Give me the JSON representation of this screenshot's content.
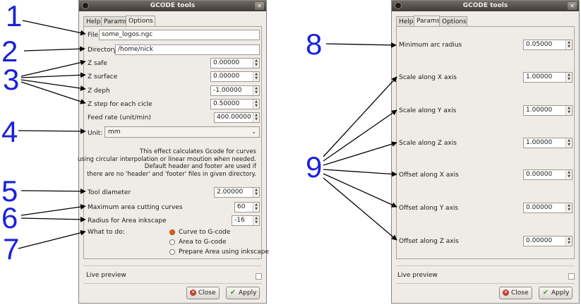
{
  "left": {
    "title": "GCODE tools",
    "tabs": [
      "Help",
      "Params",
      "Options"
    ],
    "active_tab": "Options",
    "file": {
      "label": "File",
      "value": "some_logos.ngc"
    },
    "directory": {
      "label": "Directory",
      "value": "/home/nick"
    },
    "z_safe": {
      "label": "Z safe",
      "value": "0.00000"
    },
    "z_surface": {
      "label": "Z surface",
      "value": "0.00000"
    },
    "z_deph": {
      "label": "Z deph",
      "value": "-1.00000"
    },
    "z_step": {
      "label": "Z step for each cicle",
      "value": "0.50000"
    },
    "feed_rate": {
      "label": "Feed rate (unit/min)",
      "value": "400.00000"
    },
    "unit": {
      "label": "Unit:",
      "value": "mm"
    },
    "description": [
      "This effect calculates Gcode for curves",
      "using circular interpolation or linear moution when needed.",
      "Default header and footer are used if",
      "there are no 'header' and 'footer' files in given directory."
    ],
    "tool_diameter": {
      "label": "Tool diameter",
      "value": "2.00000"
    },
    "max_area_curves": {
      "label": "Maximum area cutting curves",
      "value": "60"
    },
    "radius_area": {
      "label": "Radius for Area inkscape",
      "value": "-16"
    },
    "what_to_do": {
      "label": "What to do:",
      "options": [
        "Curve to G-code",
        "Area to G-code",
        "Prepare Area using inkscape"
      ],
      "selected": 0
    },
    "live_preview": "Live preview",
    "close": "Close",
    "apply": "Apply"
  },
  "right": {
    "title": "GCODE tools",
    "tabs": [
      "Help",
      "Params",
      "Options"
    ],
    "active_tab": "Params",
    "min_arc_radius": {
      "label": "Minimum arc radius",
      "value": "0.05000"
    },
    "scale_x": {
      "label": "Scale along X axis",
      "value": "1.00000"
    },
    "scale_y": {
      "label": "Scale along Y axis",
      "value": "1.00000"
    },
    "scale_z": {
      "label": "Scale along Z axis",
      "value": "1.00000"
    },
    "offset_x": {
      "label": "Offset along X axis",
      "value": "0.00000"
    },
    "offset_y": {
      "label": "Offset along Y axis",
      "value": "0.00000"
    },
    "offset_z": {
      "label": "Offset along Z axis",
      "value": "0.00000"
    },
    "live_preview": "Live preview",
    "close": "Close",
    "apply": "Apply"
  },
  "annotations": [
    "1",
    "2",
    "3",
    "4",
    "5",
    "6",
    "7",
    "8",
    "9"
  ],
  "colors": {
    "annotation": "#1a22d8",
    "radio_selected": "#e0601c",
    "apply_check": "#4a9a1a",
    "close_icon": "#c0392b"
  }
}
